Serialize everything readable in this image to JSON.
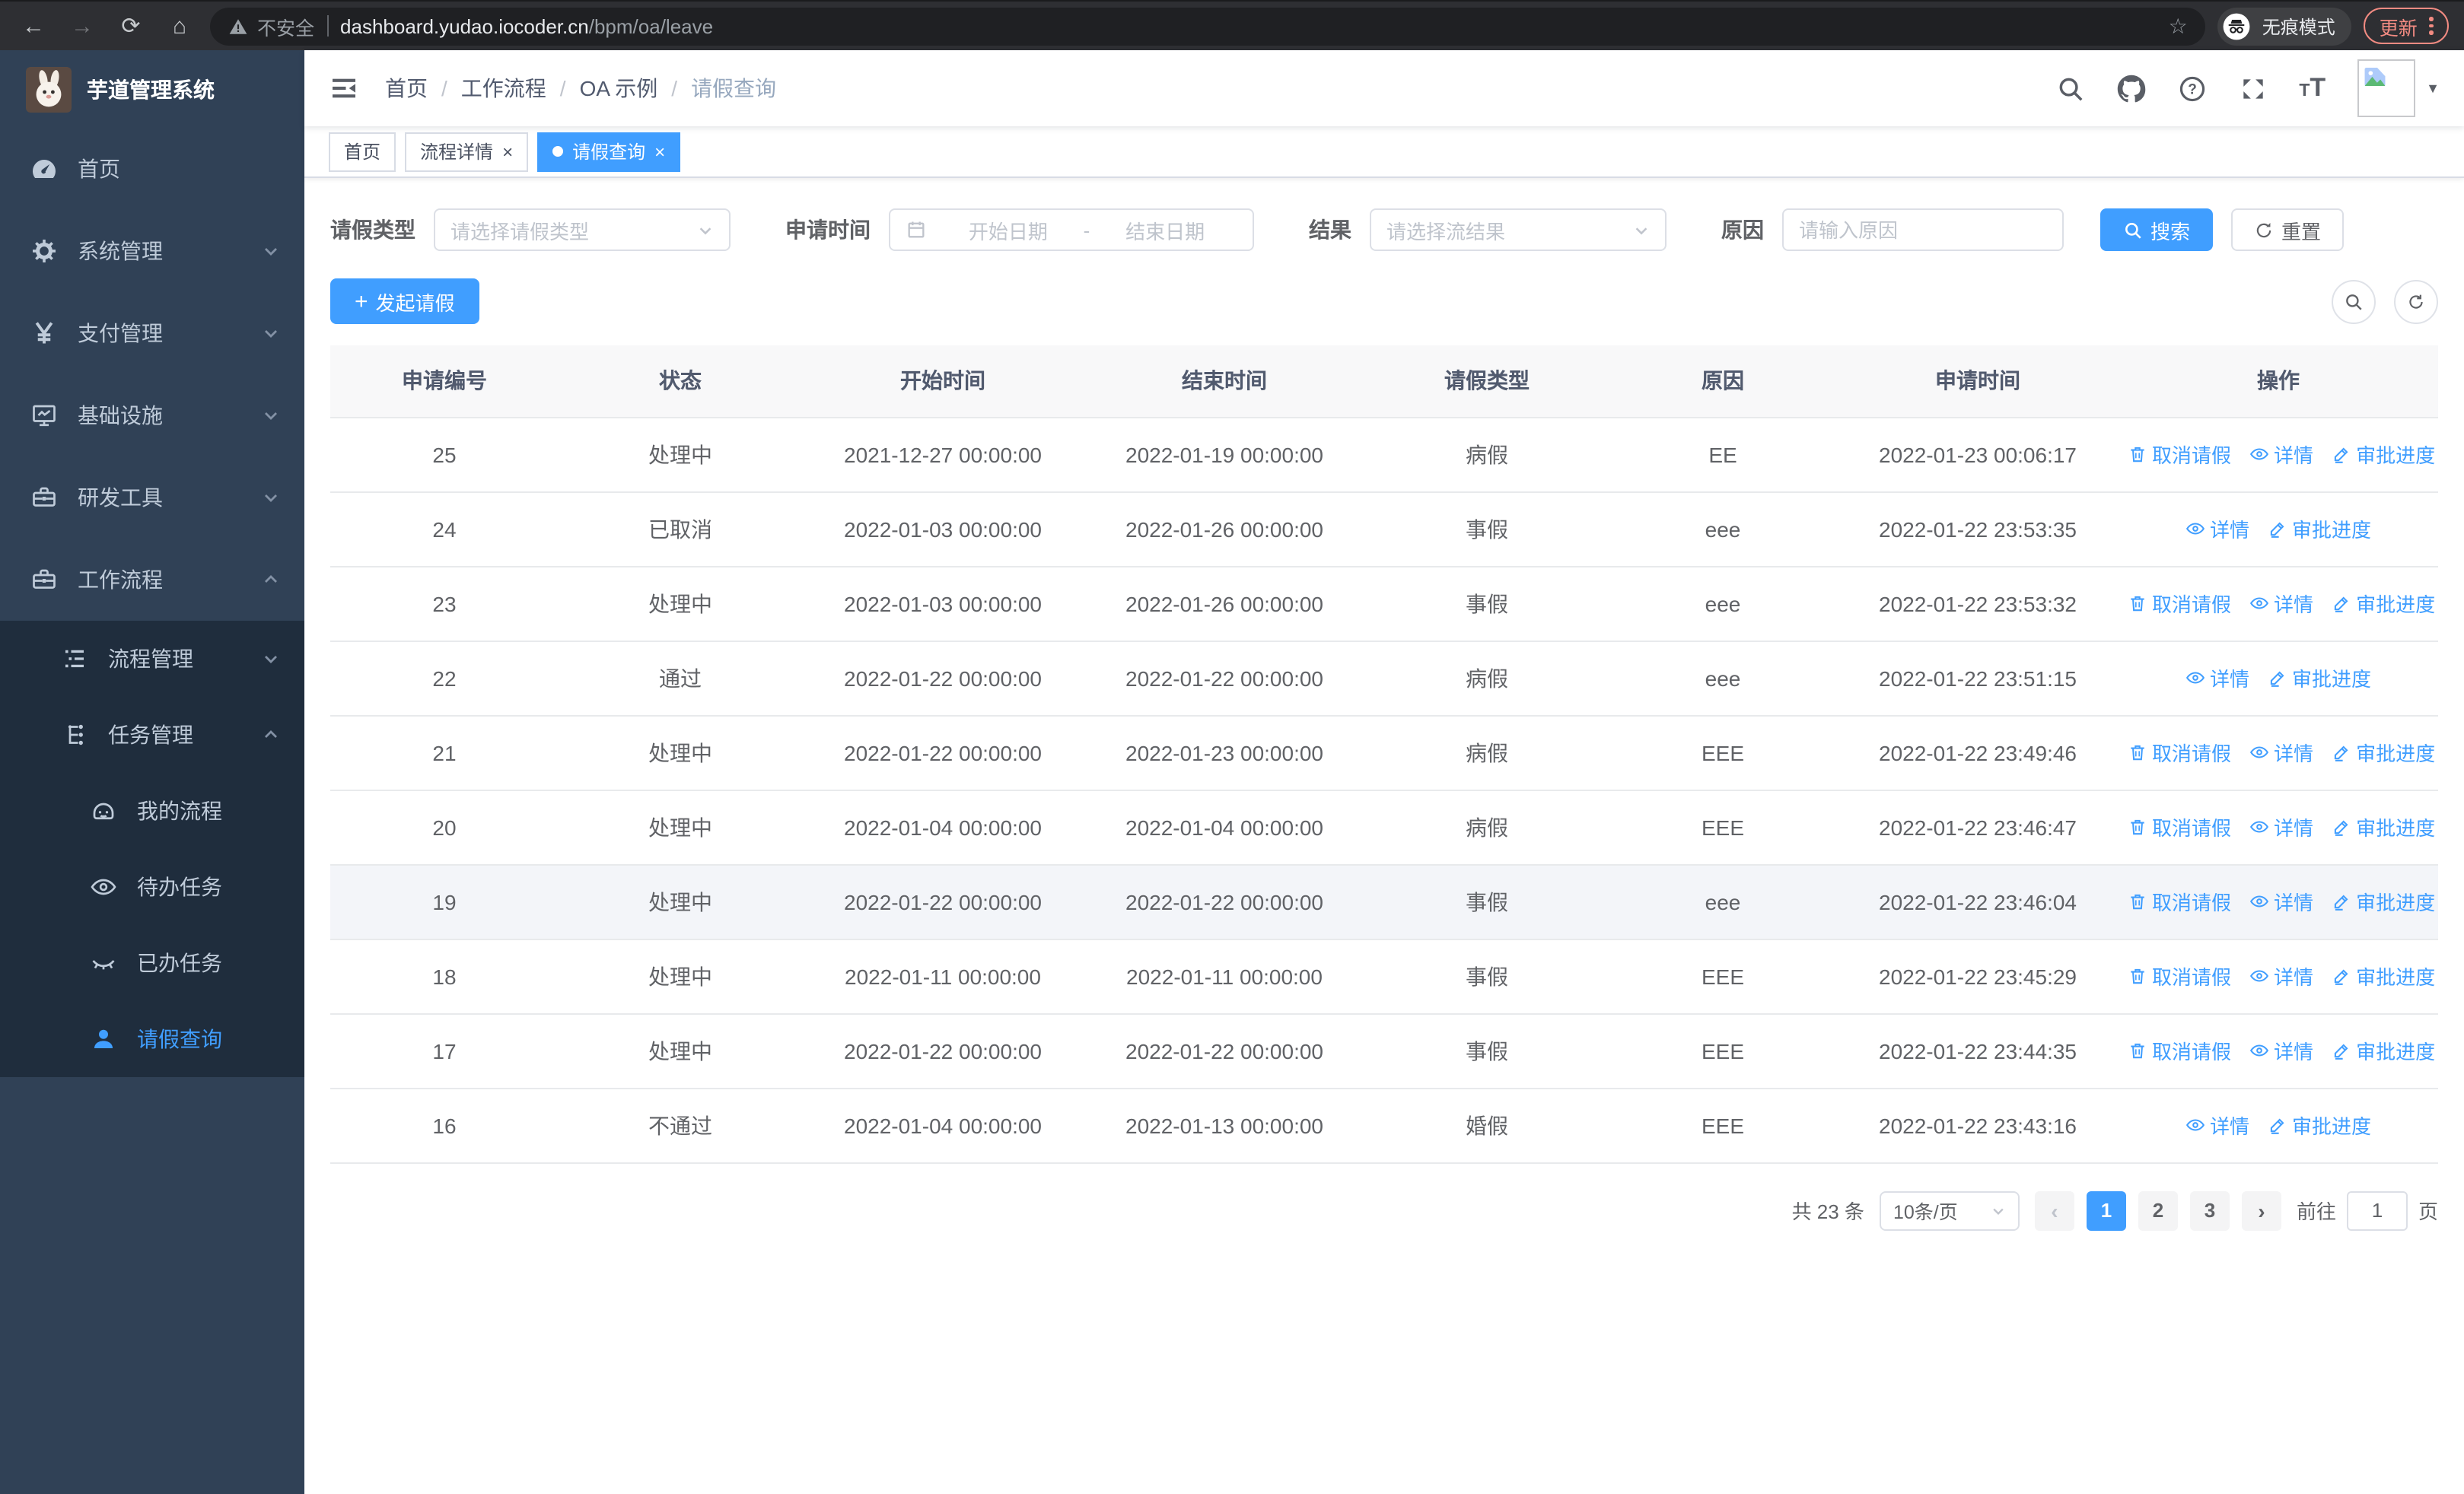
{
  "browser": {
    "security_warning": "不安全",
    "url_host": "dashboard.yudao.iocoder.cn",
    "url_path": "/bpm/oa/leave",
    "incognito_label": "无痕模式",
    "update_label": "更新"
  },
  "sidebar": {
    "app_title": "芋道管理系统",
    "items": [
      {
        "key": "home",
        "label": "首页",
        "icon": "dashboard-icon",
        "level": 1,
        "expandable": false,
        "active": false
      },
      {
        "key": "system-management",
        "label": "系统管理",
        "icon": "gear-icon",
        "level": 1,
        "expandable": true,
        "expanded": false,
        "active": false
      },
      {
        "key": "payment-management",
        "label": "支付管理",
        "icon": "yen-icon",
        "level": 1,
        "expandable": true,
        "expanded": false,
        "active": false
      },
      {
        "key": "infrastructure",
        "label": "基础设施",
        "icon": "monitor-icon",
        "level": 1,
        "expandable": true,
        "expanded": false,
        "active": false
      },
      {
        "key": "dev-tools",
        "label": "研发工具",
        "icon": "toolbox-icon",
        "level": 1,
        "expandable": true,
        "expanded": false,
        "active": false
      },
      {
        "key": "workflow",
        "label": "工作流程",
        "icon": "briefcase-icon",
        "level": 1,
        "expandable": true,
        "expanded": true,
        "active": false
      },
      {
        "key": "process-management",
        "label": "流程管理",
        "icon": "list-tree-icon",
        "level": 2,
        "expandable": true,
        "expanded": false,
        "active": false
      },
      {
        "key": "task-management",
        "label": "任务管理",
        "icon": "flow-icon",
        "level": 2,
        "expandable": true,
        "expanded": true,
        "active": false
      },
      {
        "key": "my-process",
        "label": "我的流程",
        "icon": "face-icon",
        "level": 3,
        "expandable": false,
        "active": false
      },
      {
        "key": "todo-tasks",
        "label": "待办任务",
        "icon": "eye-icon",
        "level": 3,
        "expandable": false,
        "active": false
      },
      {
        "key": "done-tasks",
        "label": "已办任务",
        "icon": "eye-closed-icon",
        "level": 3,
        "expandable": false,
        "active": false
      },
      {
        "key": "leave-query",
        "label": "请假查询",
        "icon": "user-icon",
        "level": 3,
        "expandable": false,
        "active": true
      }
    ]
  },
  "header": {
    "breadcrumb": [
      {
        "label": "首页",
        "current": false
      },
      {
        "label": "工作流程",
        "current": false
      },
      {
        "label": "OA 示例",
        "current": false
      },
      {
        "label": "请假查询",
        "current": true
      }
    ]
  },
  "tabs": [
    {
      "label": "首页",
      "closable": false,
      "active": false
    },
    {
      "label": "流程详情",
      "closable": true,
      "active": false
    },
    {
      "label": "请假查询",
      "closable": true,
      "active": true
    }
  ],
  "filters": {
    "leave_type_label": "请假类型",
    "leave_type_placeholder": "请选择请假类型",
    "apply_time_label": "申请时间",
    "start_date_placeholder": "开始日期",
    "date_separator": "-",
    "end_date_placeholder": "结束日期",
    "result_label": "结果",
    "result_placeholder": "请选择流结果",
    "reason_label": "原因",
    "reason_placeholder": "请输入原因",
    "search_label": "搜索",
    "reset_label": "重置"
  },
  "toolbar": {
    "create_label": "发起请假"
  },
  "table": {
    "columns": [
      "申请编号",
      "状态",
      "开始时间",
      "结束时间",
      "请假类型",
      "原因",
      "申请时间",
      "操作"
    ],
    "action_labels": {
      "cancel": "取消请假",
      "detail": "详情",
      "progress": "审批进度"
    },
    "rows": [
      {
        "id": "25",
        "status": "处理中",
        "start": "2021-12-27 00:00:00",
        "end": "2022-01-19 00:00:00",
        "type": "病假",
        "reason": "EE",
        "applied": "2022-01-23 00:06:17",
        "actions": [
          "cancel",
          "detail",
          "progress"
        ],
        "highlight": false
      },
      {
        "id": "24",
        "status": "已取消",
        "start": "2022-01-03 00:00:00",
        "end": "2022-01-26 00:00:00",
        "type": "事假",
        "reason": "eee",
        "applied": "2022-01-22 23:53:35",
        "actions": [
          "detail",
          "progress"
        ],
        "highlight": false
      },
      {
        "id": "23",
        "status": "处理中",
        "start": "2022-01-03 00:00:00",
        "end": "2022-01-26 00:00:00",
        "type": "事假",
        "reason": "eee",
        "applied": "2022-01-22 23:53:32",
        "actions": [
          "cancel",
          "detail",
          "progress"
        ],
        "highlight": false
      },
      {
        "id": "22",
        "status": "通过",
        "start": "2022-01-22 00:00:00",
        "end": "2022-01-22 00:00:00",
        "type": "病假",
        "reason": "eee",
        "applied": "2022-01-22 23:51:15",
        "actions": [
          "detail",
          "progress"
        ],
        "highlight": false
      },
      {
        "id": "21",
        "status": "处理中",
        "start": "2022-01-22 00:00:00",
        "end": "2022-01-23 00:00:00",
        "type": "病假",
        "reason": "EEE",
        "applied": "2022-01-22 23:49:46",
        "actions": [
          "cancel",
          "detail",
          "progress"
        ],
        "highlight": false
      },
      {
        "id": "20",
        "status": "处理中",
        "start": "2022-01-04 00:00:00",
        "end": "2022-01-04 00:00:00",
        "type": "病假",
        "reason": "EEE",
        "applied": "2022-01-22 23:46:47",
        "actions": [
          "cancel",
          "detail",
          "progress"
        ],
        "highlight": false
      },
      {
        "id": "19",
        "status": "处理中",
        "start": "2022-01-22 00:00:00",
        "end": "2022-01-22 00:00:00",
        "type": "事假",
        "reason": "eee",
        "applied": "2022-01-22 23:46:04",
        "actions": [
          "cancel",
          "detail",
          "progress"
        ],
        "highlight": true
      },
      {
        "id": "18",
        "status": "处理中",
        "start": "2022-01-11 00:00:00",
        "end": "2022-01-11 00:00:00",
        "type": "事假",
        "reason": "EEE",
        "applied": "2022-01-22 23:45:29",
        "actions": [
          "cancel",
          "detail",
          "progress"
        ],
        "highlight": false
      },
      {
        "id": "17",
        "status": "处理中",
        "start": "2022-01-22 00:00:00",
        "end": "2022-01-22 00:00:00",
        "type": "事假",
        "reason": "EEE",
        "applied": "2022-01-22 23:44:35",
        "actions": [
          "cancel",
          "detail",
          "progress"
        ],
        "highlight": false
      },
      {
        "id": "16",
        "status": "不通过",
        "start": "2022-01-04 00:00:00",
        "end": "2022-01-13 00:00:00",
        "type": "婚假",
        "reason": "EEE",
        "applied": "2022-01-22 23:43:16",
        "actions": [
          "detail",
          "progress"
        ],
        "highlight": false
      }
    ]
  },
  "pagination": {
    "total_label": "共 23 条",
    "page_size": "10条/页",
    "pages": [
      "1",
      "2",
      "3"
    ],
    "active_page": "1",
    "prev_symbol": "‹",
    "next_symbol": "›",
    "goto_label": "前往",
    "goto_value": "1",
    "page_suffix": "页"
  },
  "colors": {
    "primary": "#409eff",
    "sidebar_bg": "#304156",
    "submenu_bg": "#1f2d3d",
    "update_accent": "#f28b82"
  }
}
